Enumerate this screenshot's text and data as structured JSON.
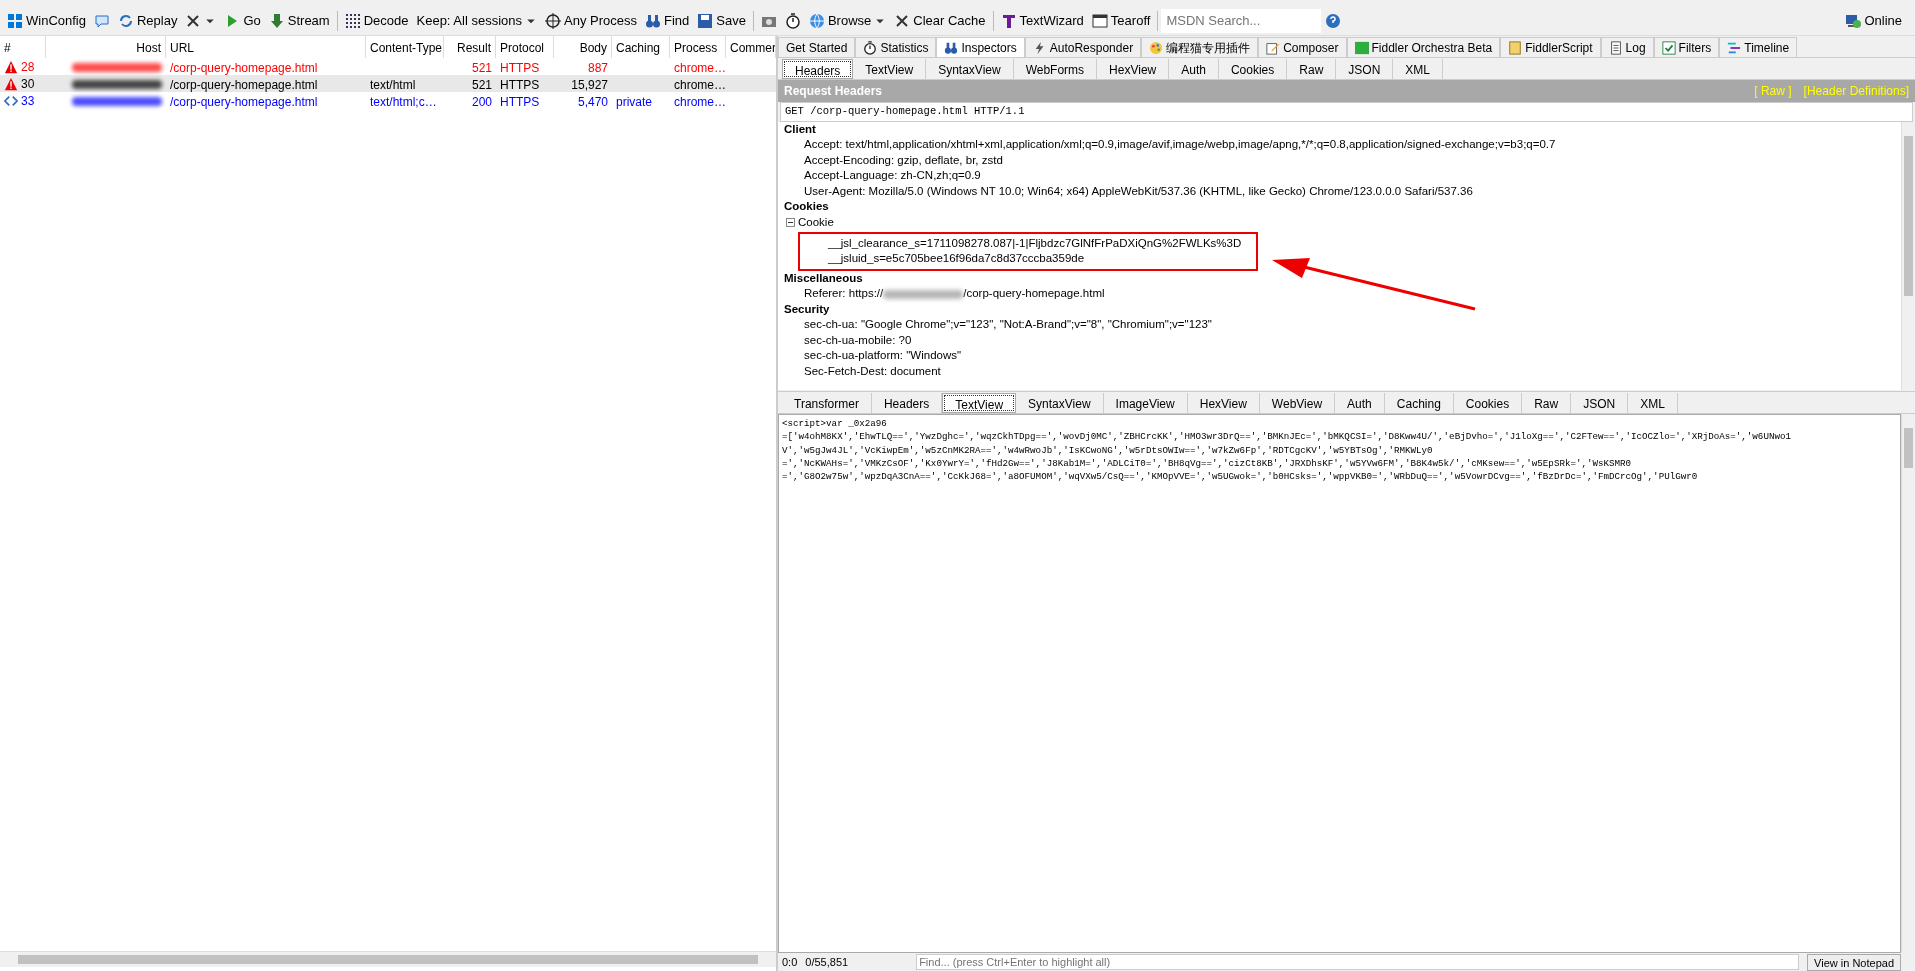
{
  "toolbar": [
    {
      "kind": "labeled",
      "label": "WinConfig"
    },
    {
      "kind": "icon"
    },
    {
      "kind": "labeled",
      "label": "Replay"
    },
    {
      "kind": "icon",
      "caret": true
    },
    {
      "kind": "labeled",
      "label": "Go"
    },
    {
      "kind": "labeled",
      "label": "Stream"
    },
    {
      "kind": "labeled",
      "label": "Decode"
    },
    {
      "kind": "labeled",
      "label": "Keep: All sessions",
      "caret": true
    },
    {
      "kind": "labeled",
      "label": "Any Process"
    },
    {
      "kind": "labeled",
      "label": "Find"
    },
    {
      "kind": "labeled",
      "label": "Save"
    },
    {
      "kind": "icon"
    },
    {
      "kind": "icon"
    },
    {
      "kind": "labeled",
      "label": "Browse",
      "caret": true
    },
    {
      "kind": "labeled",
      "label": "Clear Cache"
    },
    {
      "kind": "labeled",
      "label": "TextWizard"
    },
    {
      "kind": "labeled",
      "label": "Tearoff"
    }
  ],
  "search": {
    "placeholder": "MSDN Search..."
  },
  "online": "Online",
  "sessions": {
    "columns": [
      "#",
      "Host",
      "URL",
      "Content-Type",
      "Result",
      "Protocol",
      "Body",
      "Caching",
      "Process",
      "Commer"
    ],
    "rows": [
      {
        "id": "28",
        "kind": "warning",
        "url": "/corp-query-homepage.html",
        "content_type": "",
        "result": "521",
        "protocol": "HTTPS",
        "body": "887",
        "caching": "",
        "process": "chrome…",
        "color": "#ff0000",
        "selected": false
      },
      {
        "id": "30",
        "kind": "warning",
        "url": "/corp-query-homepage.html",
        "content_type": "text/html",
        "result": "521",
        "protocol": "HTTPS",
        "body": "15,927",
        "caching": "",
        "process": "chrome…",
        "color": "#000000",
        "selected": true
      },
      {
        "id": "33",
        "kind": "code",
        "url": "/corp-query-homepage.html",
        "content_type": "text/html;c…",
        "result": "200",
        "protocol": "HTTPS",
        "body": "5,470",
        "caching": "private",
        "process": "chrome…",
        "color": "#0000ff",
        "selected": false
      }
    ]
  },
  "main_tabs": [
    {
      "label": "Get Started",
      "selected": false
    },
    {
      "label": "Statistics",
      "selected": false
    },
    {
      "label": "Inspectors",
      "selected": true
    },
    {
      "label": "AutoResponder",
      "selected": false
    },
    {
      "label": "编程猫专用插件",
      "selected": false
    },
    {
      "label": "Composer",
      "selected": false
    },
    {
      "label": "Fiddler Orchestra Beta",
      "selected": false
    },
    {
      "label": "FiddlerScript",
      "selected": false
    },
    {
      "label": "Log",
      "selected": false
    },
    {
      "label": "Filters",
      "selected": false
    },
    {
      "label": "Timeline",
      "selected": false
    }
  ],
  "request_tabs": [
    {
      "label": "Headers",
      "selected": true
    },
    {
      "label": "TextView",
      "selected": false
    },
    {
      "label": "SyntaxView",
      "selected": false
    },
    {
      "label": "WebForms",
      "selected": false
    },
    {
      "label": "HexView",
      "selected": false
    },
    {
      "label": "Auth",
      "selected": false
    },
    {
      "label": "Cookies",
      "selected": false
    },
    {
      "label": "Raw",
      "selected": false
    },
    {
      "label": "JSON",
      "selected": false
    },
    {
      "label": "XML",
      "selected": false
    }
  ],
  "request_headers": {
    "title": "Request Headers",
    "links": [
      "[ Raw ]",
      "[Header Definitions]"
    ],
    "request_line": "GET /corp-query-homepage.html HTTP/1.1",
    "groups": [
      {
        "name": "Client",
        "entries": [
          {
            "text": "Accept: text/html,application/xhtml+xml,application/xml;q=0.9,image/avif,image/webp,image/apng,*/*;q=0.8,application/signed-exchange;v=b3;q=0.7"
          },
          {
            "text": "Accept-Encoding: gzip, deflate, br, zstd"
          },
          {
            "text": "Accept-Language: zh-CN,zh;q=0.9"
          },
          {
            "text": "User-Agent: Mozilla/5.0 (Windows NT 10.0; Win64; x64) AppleWebKit/537.36 (KHTML, like Gecko) Chrome/123.0.0.0 Safari/537.36"
          }
        ]
      },
      {
        "name": "Cookies",
        "entries": [
          {
            "text": "Cookie",
            "expanded": true,
            "children": [
              {
                "text": "__jsl_clearance_s=1711098278.087|-1|Fljbdzc7GlNfFrPaDXiQnG%2FWLKs%3D"
              },
              {
                "text": "__jsluid_s=e5c705bee16f96da7c8d37cccba359de"
              }
            ]
          }
        ]
      },
      {
        "name": "Miscellaneous",
        "entries": [
          {
            "text": "Referer: https://",
            "blurred_tail": "/corp-query-homepage.html"
          }
        ]
      },
      {
        "name": "Security",
        "entries": [
          {
            "text": "sec-ch-ua: \"Google Chrome\";v=\"123\", \"Not:A-Brand\";v=\"8\", \"Chromium\";v=\"123\""
          },
          {
            "text": "sec-ch-ua-mobile: ?0"
          },
          {
            "text": "sec-ch-ua-platform: \"Windows\""
          },
          {
            "text": "Sec-Fetch-Dest: document"
          }
        ]
      }
    ]
  },
  "annotation": {
    "kind": "box-with-arrow"
  },
  "response_tabs": [
    {
      "label": "Transformer",
      "selected": false
    },
    {
      "label": "Headers",
      "selected": false
    },
    {
      "label": "TextView",
      "selected": true
    },
    {
      "label": "SyntaxView",
      "selected": false
    },
    {
      "label": "ImageView",
      "selected": false
    },
    {
      "label": "HexView",
      "selected": false
    },
    {
      "label": "WebView",
      "selected": false
    },
    {
      "label": "Auth",
      "selected": false
    },
    {
      "label": "Caching",
      "selected": false
    },
    {
      "label": "Cookies",
      "selected": false
    },
    {
      "label": "Raw",
      "selected": false
    },
    {
      "label": "JSON",
      "selected": false
    },
    {
      "label": "XML",
      "selected": false
    }
  ],
  "response_text": [
    "<script>var _0x2a96",
    "=['w4ohM8KX','EhwTLQ==','YwzDghc=','wqzCkhTDpg==','wovDj0MC','ZBHCrcKK','HMO3wr3DrQ==','BMKnJEc=','bMKQCSI=','D8Kww4U/','eBjDvho=','J1loXg==','C2FTew==','IcOCZlo=','XRjDoAs=','w6UNwo1",
    "V','w5gJw4JL','VcKiwpEm','w5zCnMK2RA==','w4wRwoJb','IsKCwoNG','w5rDtsOWIw==','w7kZw6Fp','RDTCgcKV','w5YBTsOg','RMKWLy0",
    "=','NcKWAHs=','VMKzCsOF','Kx0YwrY=','fHd2Gw==','J8Kab1M=','ADLCiT0=','BH8qVg==','cizCt8KB','JRXDhsKF','w5YVw6FM','B8K4w5k/','cMKsew==','w5EpSRk=','WsKSMR0",
    "=','G8O2w75w','wpzDqA3CnA==','CcKkJ68=','a8OFUMOM','wqVXw5/CsQ==','KMOpVVE=','w5UGwok=','b0HCsks=','wppVKB0=','WRbDuQ==','w5VowrDCvg==','fBzDrDc=','FmDCrcOg','PUlGwr0"
  ],
  "status": {
    "position": "0:0",
    "count": "0/55,851",
    "find_placeholder": "Find... (press Ctrl+Enter to highlight all)",
    "button": "View in Notepad"
  }
}
